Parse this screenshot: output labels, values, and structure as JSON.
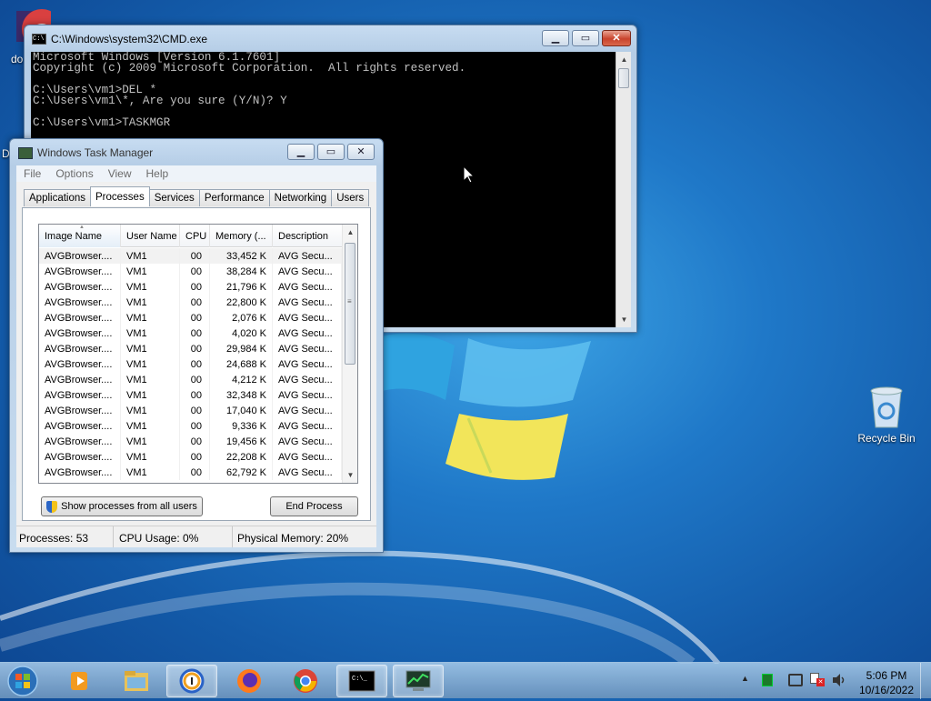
{
  "desktop": {
    "recycle_bin_label": "Recycle Bin",
    "partial_icon_label_1": "do",
    "partial_icon_label_2": "D"
  },
  "cmd": {
    "title": "C:\\Windows\\system32\\CMD.exe",
    "lines": [
      "Microsoft Windows [Version 6.1.7601]",
      "Copyright (c) 2009 Microsoft Corporation.  All rights reserved.",
      "",
      "C:\\Users\\vm1>DEL *",
      "C:\\Users\\vm1\\*, Are you sure (Y/N)? Y",
      "",
      "C:\\Users\\vm1>TASKMGR"
    ]
  },
  "taskmgr": {
    "title": "Windows Task Manager",
    "menu": [
      "File",
      "Options",
      "View",
      "Help"
    ],
    "tabs": [
      "Applications",
      "Processes",
      "Services",
      "Performance",
      "Networking",
      "Users"
    ],
    "active_tab": "Processes",
    "columns": [
      "Image Name",
      "User Name",
      "CPU",
      "Memory (...",
      "Description"
    ],
    "rows": [
      [
        "AVGBrowser....",
        "VM1",
        "00",
        "33,452 K",
        "AVG Secu..."
      ],
      [
        "AVGBrowser....",
        "VM1",
        "00",
        "38,284 K",
        "AVG Secu..."
      ],
      [
        "AVGBrowser....",
        "VM1",
        "00",
        "21,796 K",
        "AVG Secu..."
      ],
      [
        "AVGBrowser....",
        "VM1",
        "00",
        "22,800 K",
        "AVG Secu..."
      ],
      [
        "AVGBrowser....",
        "VM1",
        "00",
        "2,076 K",
        "AVG Secu..."
      ],
      [
        "AVGBrowser....",
        "VM1",
        "00",
        "4,020 K",
        "AVG Secu..."
      ],
      [
        "AVGBrowser....",
        "VM1",
        "00",
        "29,984 K",
        "AVG Secu..."
      ],
      [
        "AVGBrowser....",
        "VM1",
        "00",
        "24,688 K",
        "AVG Secu..."
      ],
      [
        "AVGBrowser....",
        "VM1",
        "00",
        "4,212 K",
        "AVG Secu..."
      ],
      [
        "AVGBrowser....",
        "VM1",
        "00",
        "32,348 K",
        "AVG Secu..."
      ],
      [
        "AVGBrowser....",
        "VM1",
        "00",
        "17,040 K",
        "AVG Secu..."
      ],
      [
        "AVGBrowser....",
        "VM1",
        "00",
        "9,336 K",
        "AVG Secu..."
      ],
      [
        "AVGBrowser....",
        "VM1",
        "00",
        "19,456 K",
        "AVG Secu..."
      ],
      [
        "AVGBrowser....",
        "VM1",
        "00",
        "22,208 K",
        "AVG Secu..."
      ],
      [
        "AVGBrowser....",
        "VM1",
        "00",
        "62,792 K",
        "AVG Secu..."
      ]
    ],
    "show_all_label": "Show processes from all users",
    "end_process_label": "End Process",
    "status": {
      "processes": "Processes: 53",
      "cpu": "CPU Usage: 0%",
      "memory": "Physical Memory: 20%"
    }
  },
  "taskbar": {
    "time": "5:06 PM",
    "date": "10/16/2022",
    "apps": [
      "windows-media-player-icon",
      "file-explorer-icon",
      "avg-browser-icon",
      "firefox-icon",
      "chrome-icon",
      "cmd-icon",
      "task-manager-icon"
    ],
    "tray_icons": [
      "show-hidden-icons-arrow",
      "system-monitor-icon",
      "network-icon",
      "action-center-icon",
      "volume-icon"
    ]
  },
  "colors": {
    "console_bg": "#000000",
    "console_fg": "#c0c0c0",
    "desktop_blue": "#1f78c8"
  }
}
